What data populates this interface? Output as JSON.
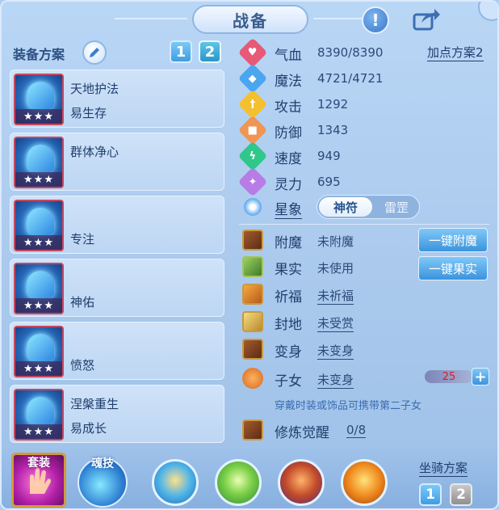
{
  "header": {
    "title": "战备"
  },
  "equip_scheme": {
    "label": "装备方案",
    "pages": [
      "1",
      "2"
    ],
    "items": [
      {
        "name_top": "天地护法",
        "name_bottom": "易生存",
        "stars": "★★★"
      },
      {
        "name_top": "群体净心",
        "name_bottom": "",
        "stars": "★★★"
      },
      {
        "name_top": "",
        "name_bottom": "专注",
        "stars": "★★★"
      },
      {
        "name_top": "",
        "name_bottom": "神佑",
        "stars": "★★★"
      },
      {
        "name_top": "",
        "name_bottom": "愤怒",
        "stars": "★★★"
      },
      {
        "name_top": "涅槃重生",
        "name_bottom": "易成长",
        "stars": "★★★"
      }
    ]
  },
  "stats": {
    "add_points_label": "加点方案2",
    "items": [
      {
        "label": "气血",
        "value": "8390/8390",
        "color": "#e65a78",
        "icon": "heart-icon",
        "glyph": "♥"
      },
      {
        "label": "魔法",
        "value": "4721/4721",
        "color": "#4aa6ef",
        "icon": "mana-icon",
        "glyph": "◆"
      },
      {
        "label": "攻击",
        "value": "1292",
        "color": "#f4c02f",
        "icon": "sword-icon",
        "glyph": "†"
      },
      {
        "label": "防御",
        "value": "1343",
        "color": "#f09655",
        "icon": "shield-icon",
        "glyph": "■"
      },
      {
        "label": "速度",
        "value": "949",
        "color": "#2fc78a",
        "icon": "lightning-icon",
        "glyph": "ϟ"
      },
      {
        "label": "灵力",
        "value": "695",
        "color": "#b77ce6",
        "icon": "spirit-icon",
        "glyph": "✦"
      }
    ]
  },
  "star_sign": {
    "label": "星象",
    "toggle_on": "神符",
    "toggle_off": "雷罡"
  },
  "rows": [
    {
      "label": "附魔",
      "value": "未附魔",
      "underline": false
    },
    {
      "label": "果实",
      "value": "未使用",
      "underline": false
    },
    {
      "label": "祈福",
      "value": "未祈福",
      "underline": true
    },
    {
      "label": "封地",
      "value": "未受赏",
      "underline": true
    },
    {
      "label": "变身",
      "value": "未变身",
      "underline": true
    },
    {
      "label": "子女",
      "value": "未变身",
      "underline": true
    },
    {
      "label": "修炼觉醒",
      "value": "0/8",
      "underline": true
    }
  ],
  "actions": {
    "enchant": "一键附魔",
    "fruit": "一键果实"
  },
  "child": {
    "count": "25",
    "plus": "+",
    "hint": "穿戴时装或饰品可携带第二子女"
  },
  "bottom": {
    "suit_label": "套装",
    "soul_label": "魂技",
    "mount_label": "坐骑方案",
    "mount_pages": [
      "1",
      "2"
    ]
  }
}
